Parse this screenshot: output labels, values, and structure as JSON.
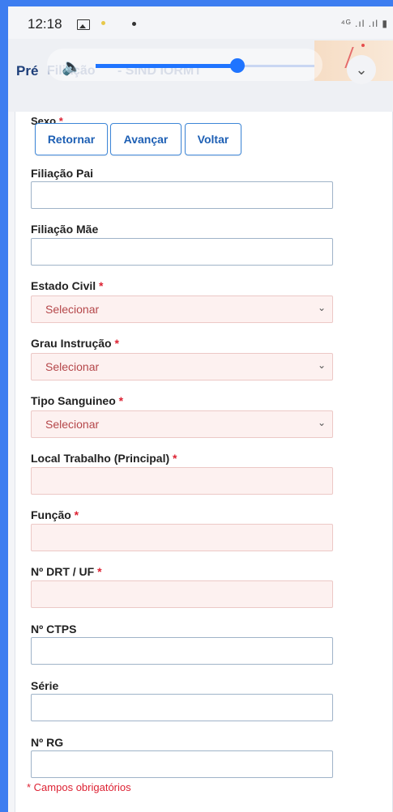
{
  "status_bar": {
    "time": "12:18",
    "right_text": "⁴ᴳ .ıl .ıl ▮"
  },
  "header": {
    "title_prefix": "Pré",
    "title_faded_1": "Filiação",
    "title_faded_2": "- SIND IORMT"
  },
  "media": {
    "volume_level_percent": 68
  },
  "form": {
    "cut_label": "Sexo",
    "buttons": {
      "back": "Retornar",
      "forward": "Avançar",
      "return": "Voltar"
    },
    "fields": {
      "father": {
        "label": "Filiação Pai",
        "value": ""
      },
      "mother": {
        "label": "Filiação Mãe",
        "value": ""
      },
      "civil_status": {
        "label": "Estado Civil",
        "selected": "Selecionar"
      },
      "education": {
        "label": "Grau Instrução",
        "selected": "Selecionar"
      },
      "blood_type": {
        "label": "Tipo Sanguineo",
        "selected": "Selecionar"
      },
      "workplace": {
        "label": "Local Trabalho (Principal)",
        "value": ""
      },
      "function": {
        "label": "Função",
        "value": ""
      },
      "drt": {
        "label": "Nº DRT / UF",
        "value": ""
      },
      "ctps": {
        "label": "Nº CTPS",
        "value": ""
      },
      "series": {
        "label": "Série",
        "value": ""
      },
      "rg": {
        "label": "Nº RG",
        "value": ""
      }
    },
    "required_mark": "*",
    "footer_note": "* Campos obrigatórios"
  },
  "colors": {
    "frame_blue": "#3d7df0",
    "button_border": "#3d86d8",
    "required_red": "#d22233",
    "required_bg": "#fdf1f0"
  }
}
